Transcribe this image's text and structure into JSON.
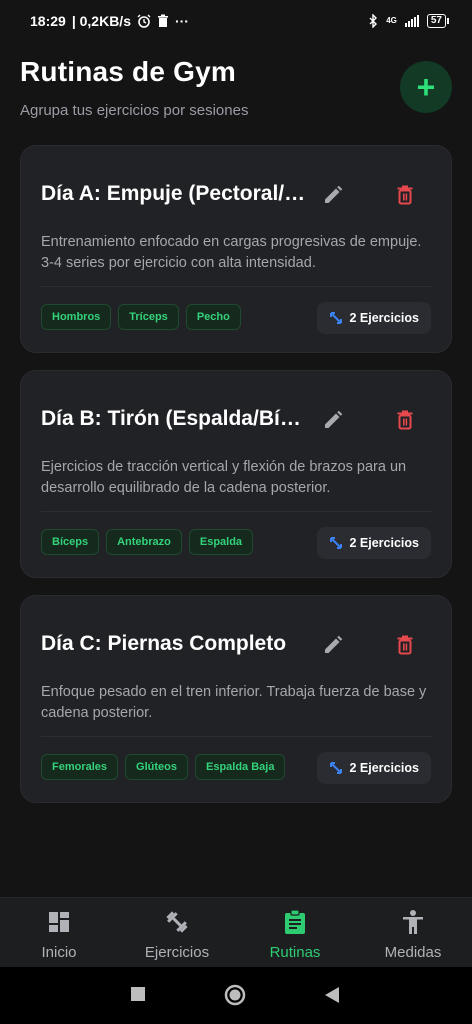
{
  "status_bar": {
    "time": "18:29",
    "speed": "| 0,2KB/s",
    "network": "4G",
    "battery": "57"
  },
  "header": {
    "title": "Rutinas de Gym",
    "subtitle": "Agrupa tus ejercicios por sesiones",
    "add_label": "+"
  },
  "routines": [
    {
      "title": "Día A: Empuje (Pectoral/Hombros/Tríceps)",
      "description": "Entrenamiento enfocado en cargas progresivas de empuje. 3-4 series por ejercicio con alta intensidad.",
      "tags": [
        "Hombros",
        "Tríceps",
        "Pecho"
      ],
      "count": "2 Ejercicios"
    },
    {
      "title": "Día B: Tirón (Espalda/Bíceps)",
      "description": "Ejercicios de tracción vertical y flexión de brazos para un desarrollo equilibrado de la cadena posterior.",
      "tags": [
        "Bíceps",
        "Antebrazo",
        "Espalda"
      ],
      "count": "2 Ejercicios"
    },
    {
      "title": "Día C: Piernas Completo",
      "description": "Enfoque pesado en el tren inferior. Trabaja fuerza de base y cadena posterior.",
      "tags": [
        "Femorales",
        "Glúteos",
        "Espalda Baja"
      ],
      "count": "2 Ejercicios"
    }
  ],
  "nav": {
    "items": [
      {
        "label": "Inicio",
        "icon": "dashboard-icon"
      },
      {
        "label": "Ejercicios",
        "icon": "dumbbell-icon"
      },
      {
        "label": "Rutinas",
        "icon": "clipboard-icon",
        "active": true
      },
      {
        "label": "Medidas",
        "icon": "person-icon"
      }
    ]
  },
  "colors": {
    "accent": "#2ecc71",
    "delete": "#e5484d",
    "background": "#141415",
    "card": "#212225"
  }
}
